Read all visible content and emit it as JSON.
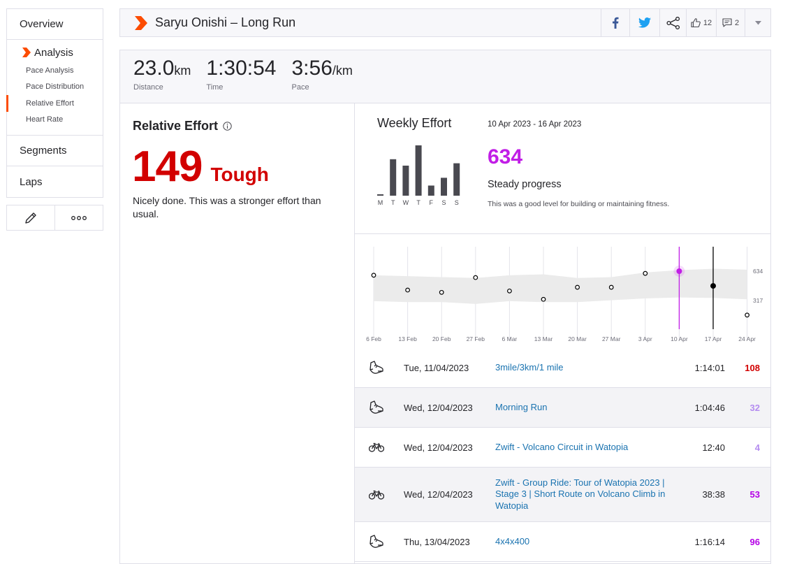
{
  "sidebar": {
    "overview": "Overview",
    "analysis": "Analysis",
    "sub_items": [
      "Pace Analysis",
      "Pace Distribution",
      "Relative Effort",
      "Heart Rate"
    ],
    "segments": "Segments",
    "laps": "Laps"
  },
  "header": {
    "title": "Saryu Onishi – Long Run",
    "kudos_count": "12",
    "comments_count": "2"
  },
  "stats": [
    {
      "value": "23.0",
      "unit": "km",
      "label": "Distance"
    },
    {
      "value": "1:30:54",
      "unit": "",
      "label": "Time"
    },
    {
      "value": "3:56",
      "unit": "/km",
      "label": "Pace"
    }
  ],
  "relative_effort": {
    "title": "Relative Effort",
    "score": "149",
    "level": "Tough",
    "description": "Nicely done. This was a stronger effort than usual."
  },
  "weekly_effort": {
    "title": "Weekly Effort",
    "date_range": "10 Apr 2023 - 16 Apr 2023",
    "total": "634",
    "status": "Steady progress",
    "note": "This was a good level for building or maintaining fitness.",
    "days": [
      "M",
      "T",
      "W",
      "T",
      "F",
      "S",
      "S"
    ],
    "day_values": [
      4,
      108,
      89,
      149,
      30,
      53,
      96
    ]
  },
  "chart_data": {
    "type": "scatter",
    "x": [
      "6 Feb",
      "13 Feb",
      "20 Feb",
      "27 Feb",
      "6 Mar",
      "13 Mar",
      "20 Mar",
      "27 Mar",
      "3 Apr",
      "10 Apr",
      "17 Apr",
      "24 Apr"
    ],
    "values": [
      590,
      430,
      405,
      565,
      420,
      330,
      460,
      460,
      610,
      634,
      475,
      160
    ],
    "band_upper": [
      590,
      580,
      570,
      560,
      590,
      600,
      560,
      570,
      620,
      645,
      660,
      650
    ],
    "band_lower": [
      310,
      300,
      300,
      280,
      310,
      300,
      300,
      320,
      340,
      350,
      345,
      330
    ],
    "y_ticks": [
      "634",
      "317"
    ],
    "highlight": "10 Apr",
    "current_marker": "17 Apr",
    "colors": {
      "highlight": "#c11ee6",
      "band": "#ebebeb",
      "point": "#000000"
    }
  },
  "activities": [
    {
      "type": "run",
      "date": "Tue, 11/04/2023",
      "name": "3mile/3km/1 mile",
      "duration": "1:14:01",
      "score": "108",
      "score_color": "#d20000"
    },
    {
      "type": "run",
      "date": "Wed, 12/04/2023",
      "name": "Morning Run",
      "duration": "1:04:46",
      "score": "32",
      "score_color": "#b48cf0"
    },
    {
      "type": "ride",
      "date": "Wed, 12/04/2023",
      "name": "Zwift - Volcano Circuit in Watopia",
      "duration": "12:40",
      "score": "4",
      "score_color": "#b48cf0"
    },
    {
      "type": "ride",
      "date": "Wed, 12/04/2023",
      "name": "Zwift - Group Ride: Tour of Watopia 2023 | Stage 3 | Short Route on Volcano Climb in Watopia",
      "duration": "38:38",
      "score": "53",
      "score_color": "#b400e6"
    },
    {
      "type": "run",
      "date": "Thu, 13/04/2023",
      "name": "4x4x400",
      "duration": "1:16:14",
      "score": "96",
      "score_color": "#b400e6"
    }
  ]
}
